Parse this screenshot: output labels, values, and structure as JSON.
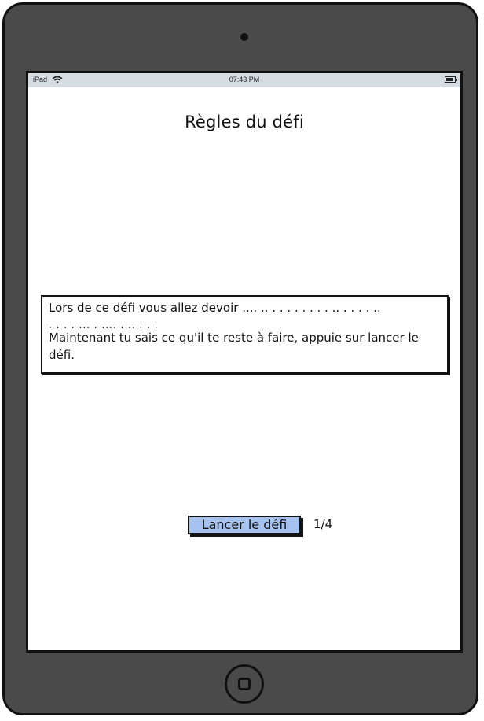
{
  "statusbar": {
    "device_label": "iPad",
    "time": "07:43 PM",
    "wifi_icon": "wifi-icon",
    "battery_icon": "battery-icon"
  },
  "screen": {
    "title": "Règles du défi",
    "rules": {
      "line1": "Lors de ce défi vous allez devoir .... .. . . .   . . .   . . .. . . . . ..",
      "line2": ". . . . ... . .... . .. . . .",
      "line3": "Maintenant tu sais ce qu'il te reste à faire, appuie sur lancer le défi."
    },
    "launch_button_label": "Lancer le défi",
    "page_counter": "1/4"
  },
  "device": {
    "home_button_icon": "home-button-icon",
    "colors": {
      "frame": "#4a4a4a",
      "statusbar": "#d6dde2",
      "button_accent": "#a6c2ee"
    }
  }
}
